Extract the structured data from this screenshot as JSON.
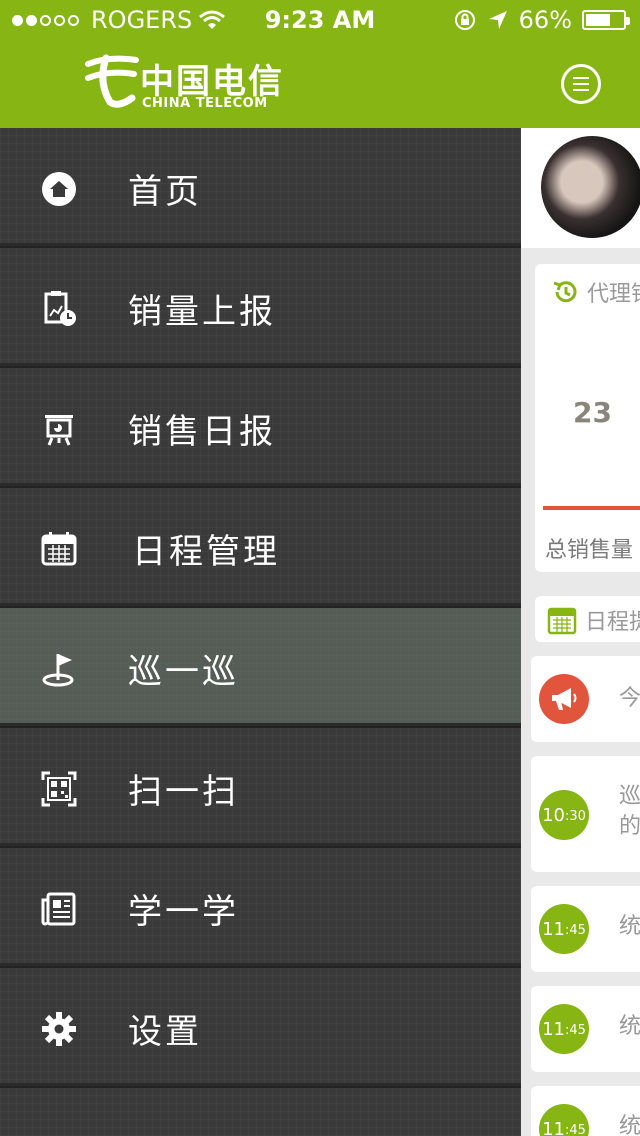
{
  "status_bar": {
    "carrier": "ROGERS",
    "time": "9:23 AM",
    "battery": "66%",
    "battery_level": 0.66
  },
  "header": {
    "logo_cn": "中国电信",
    "logo_en": "CHINA TELECOM",
    "menu_icon": "hamburger-menu-icon"
  },
  "colors": {
    "brand_green": "#86b514",
    "drawer_bg": "#3a3a3a",
    "accent_red": "#e0553c"
  },
  "menu": {
    "items": [
      {
        "label": "首页",
        "icon": "home-icon"
      },
      {
        "label": "销量上报",
        "icon": "sales-report-icon"
      },
      {
        "label": "销售日报",
        "icon": "daily-report-icon"
      },
      {
        "label": "日程管理",
        "icon": "calendar-icon"
      },
      {
        "label": "巡一巡",
        "icon": "golf-flag-icon"
      },
      {
        "label": "扫一扫",
        "icon": "qr-scan-icon"
      },
      {
        "label": "学一学",
        "icon": "newspaper-icon"
      },
      {
        "label": "设置",
        "icon": "gear-icon"
      }
    ],
    "active_index": 4
  },
  "content": {
    "sales_card": {
      "title": "代理销",
      "value": "23",
      "total_label": "总销售量"
    },
    "schedule_card": {
      "title": "日程提"
    },
    "events": [
      {
        "kind": "notice",
        "text": "今"
      },
      {
        "hour": "10",
        "minute": ":30",
        "text1": "巡",
        "text2": "的"
      },
      {
        "hour": "11",
        "minute": ":45",
        "text1": "统"
      },
      {
        "hour": "11",
        "minute": ":45",
        "text1": "统"
      },
      {
        "hour": "11",
        "minute": ":45",
        "text1": "统"
      }
    ]
  }
}
